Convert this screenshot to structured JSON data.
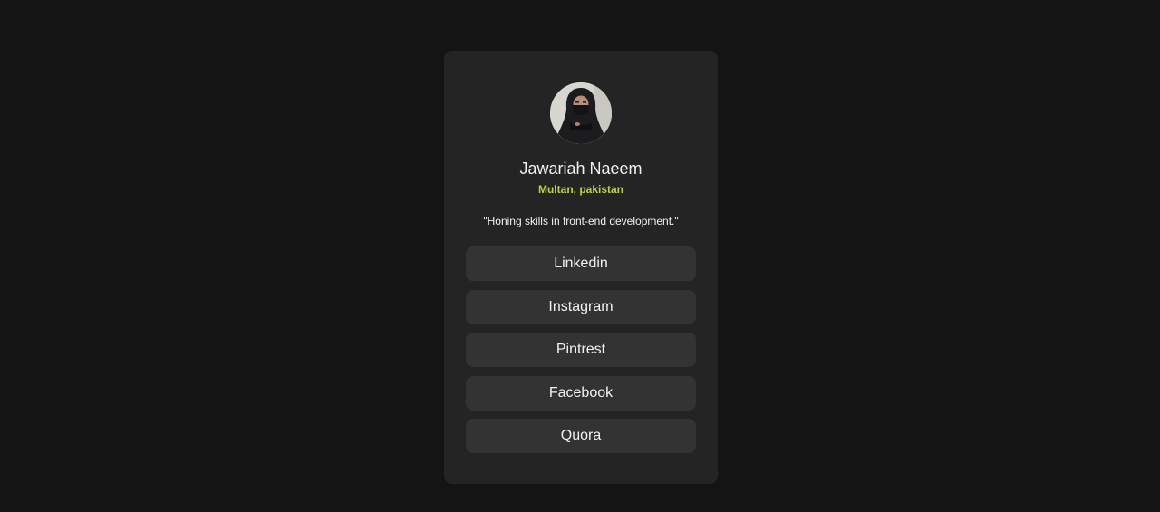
{
  "profile": {
    "name": "Jawariah Naeem",
    "location": "Multan, pakistan",
    "bio": "\"Honing skills in front-end development.\"",
    "avatar_icon": "profile-photo",
    "location_color": "#b7d640"
  },
  "links": [
    {
      "label": "Linkedin"
    },
    {
      "label": "Instagram"
    },
    {
      "label": "Pintrest"
    },
    {
      "label": "Facebook"
    },
    {
      "label": "Quora"
    }
  ],
  "colors": {
    "background": "#141414",
    "card": "#242424",
    "button": "#333333",
    "text": "#f2f2f2"
  }
}
